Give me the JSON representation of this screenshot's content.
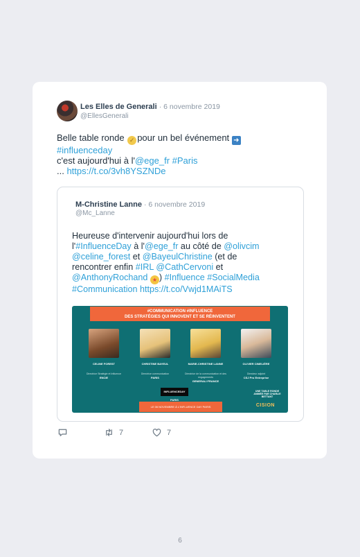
{
  "tweet": {
    "author_name": "Les Elles de Generali",
    "date": "· 6 novembre 2019",
    "handle": "@EllesGenerali",
    "text": {
      "l1_a": "Belle table ronde ",
      "l1_b": "pour un bel événement ",
      "hashtag1": "#influenceday",
      "l3_a": "c'est aujourd'hui à l'",
      "mention1": "@ege_fr",
      "hashtag2": "#Paris",
      "l4_a": "... ",
      "link": "https://t.co/3vh8YSZNDe"
    },
    "actions": {
      "retweets": "7",
      "likes": "7"
    }
  },
  "quote": {
    "author_name": "M-Christine Lanne",
    "date": "· 6 novembre 2019",
    "handle": "@Mc_Lanne",
    "text": {
      "p1": "Heureuse d'intervenir aujourd'hui lors de",
      "p2_a": "l'",
      "tag_influenceday": "#InfluenceDay",
      "p2_b": " à l'",
      "m_ege": "@ege_fr",
      "p2_c": " au côté de ",
      "m_olivcim": "@olivcim",
      "m_celine": "@celine_forest",
      "p3_a": " et ",
      "m_bayeul": "@BayeulChristine",
      "p3_b": " (et de",
      "p4_a": "rencontrer enfin ",
      "tag_irl": "#IRL",
      "m_cath": "@CathCervoni",
      "p4_b": " et",
      "m_anthony": "@AnthonyRochand",
      "p5_a": ") ",
      "tag_influence": "#Influence",
      "tag_socialmedia": "#SocialMedia",
      "tag_communication": "#Communication",
      "link": "https://t.co/Vwjd1MAiTS"
    },
    "banner": {
      "headline_1": "#COMMUNICATION #INFLUENCE",
      "headline_2": "DES STRATÉGIES QUI INNOVENT ET SE RÉINVENTENT",
      "speakers": [
        {
          "name": "CELINE FOREST",
          "role": "Directrice Stratégie et Influence",
          "org": "ENCIE"
        },
        {
          "name": "CHRISTINE BAYEUL",
          "role": "Directrice communication",
          "org": "PARIS"
        },
        {
          "name": "MARIE-CHRISTINE LANNE",
          "role": "Directrice de la communication et des engagements",
          "org": "GENERALI FRANCE"
        },
        {
          "name": "OLIVIER CIMELIÈRE",
          "role": "Directeur adjoint",
          "org": "CSJ Pro Entreprise"
        }
      ],
      "logo": "INFLUENCEDAY PARIS",
      "side_note": "UNE TABLE RONDE ANIMÉE PAR CHARLIE BETTANT",
      "footer": "LE 06 NOVEMBRE À L'INFLUENCE DAY PARIS",
      "brand": "CISION"
    }
  },
  "page": {
    "number": "6"
  }
}
